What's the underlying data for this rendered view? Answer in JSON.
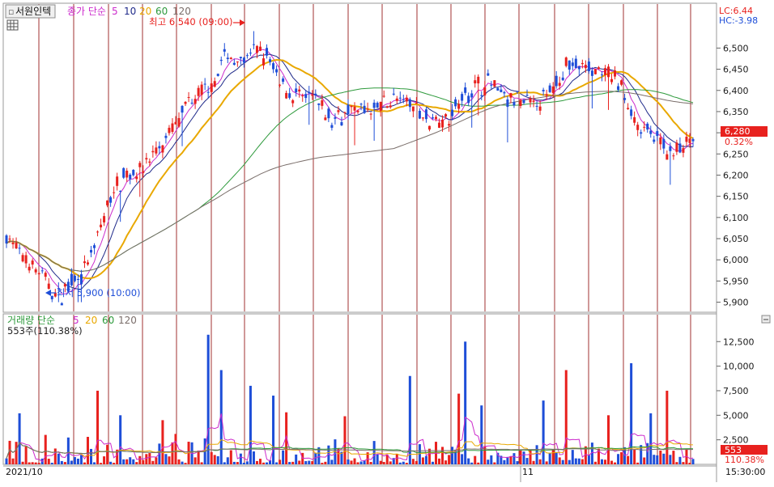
{
  "header": {
    "stock_name": "서원인텍",
    "price_legend_label": "종가 단순",
    "ma_periods": [
      "5",
      "10",
      "20",
      "60",
      "120"
    ],
    "volume_legend_label": "거래량 단순",
    "volume_ma_periods": [
      "5",
      "20",
      "60",
      "120"
    ],
    "volume_readout": "553주(110.38%)",
    "lc": "LC:6.44",
    "hc": "HC:-3.98"
  },
  "annotations": {
    "high": "최고 6,540 (09:00)",
    "low": "최저 5,900 (10:00)"
  },
  "current": {
    "price_label": "6,280",
    "change_label": "0.32%",
    "volume_label": "553",
    "volume_pct_label": "110.38%"
  },
  "footer": {
    "date_left": "2021/10",
    "date_mid": "11",
    "time_right": "15:30:00"
  },
  "colors": {
    "up": "#e8211e",
    "down": "#1e4ed8",
    "ma5": "#cc2bcc",
    "ma10": "#1f2a8a",
    "ma20": "#e9a800",
    "ma60": "#2e9a3c",
    "ma120": "#7a6e6a",
    "grid": "#a03030",
    "axis_text": "#1a1a1a",
    "label_bg": "#e8211e"
  },
  "chart_data": {
    "type": "candlestick",
    "price_axis_ticks": [
      "6,500",
      "6,450",
      "6,400",
      "6,350",
      "6,300",
      "6,250",
      "6,200",
      "6,150",
      "6,100",
      "6,050",
      "6,000",
      "5,950",
      "5,900"
    ],
    "price_range": [
      5880,
      6560
    ],
    "volume_axis_ticks": [
      "12,500",
      "10,000",
      "7,500",
      "5,000",
      "2,500"
    ],
    "volume_range": [
      0,
      14500
    ],
    "high": 6540,
    "low": 5900,
    "last_price": 6280,
    "last_volume": 553,
    "price_anchors": [
      [
        0,
        6060
      ],
      [
        4,
        6010
      ],
      [
        8,
        5990
      ],
      [
        12,
        5950
      ],
      [
        16,
        5910
      ],
      [
        20,
        5950
      ],
      [
        24,
        5970
      ],
      [
        28,
        6050
      ],
      [
        32,
        6150
      ],
      [
        36,
        6200
      ],
      [
        42,
        6220
      ],
      [
        48,
        6270
      ],
      [
        52,
        6320
      ],
      [
        57,
        6380
      ],
      [
        62,
        6400
      ],
      [
        67,
        6480
      ],
      [
        72,
        6470
      ],
      [
        76,
        6490
      ],
      [
        80,
        6480
      ],
      [
        84,
        6420
      ],
      [
        88,
        6390
      ],
      [
        94,
        6380
      ],
      [
        100,
        6330
      ],
      [
        106,
        6360
      ],
      [
        112,
        6350
      ],
      [
        118,
        6380
      ],
      [
        124,
        6370
      ],
      [
        130,
        6330
      ],
      [
        136,
        6340
      ],
      [
        142,
        6400
      ],
      [
        148,
        6420
      ],
      [
        154,
        6380
      ],
      [
        160,
        6370
      ],
      [
        166,
        6380
      ],
      [
        172,
        6460
      ],
      [
        180,
        6450
      ],
      [
        188,
        6420
      ],
      [
        194,
        6320
      ],
      [
        200,
        6280
      ],
      [
        205,
        6250
      ],
      [
        211,
        6280
      ]
    ],
    "volume_spikes": [
      [
        4,
        5200
      ],
      [
        12,
        3000
      ],
      [
        25,
        2800
      ],
      [
        28,
        7500
      ],
      [
        31,
        2000
      ],
      [
        35,
        5000
      ],
      [
        48,
        4500
      ],
      [
        52,
        3100
      ],
      [
        62,
        13200
      ],
      [
        66,
        9600
      ],
      [
        75,
        8000
      ],
      [
        82,
        7000
      ],
      [
        86,
        5300
      ],
      [
        104,
        4900
      ],
      [
        124,
        9000
      ],
      [
        139,
        7200
      ],
      [
        141,
        12500
      ],
      [
        146,
        6000
      ],
      [
        165,
        6500
      ],
      [
        172,
        9600
      ],
      [
        185,
        5000
      ],
      [
        192,
        10300
      ],
      [
        198,
        5200
      ],
      [
        203,
        7500
      ]
    ]
  }
}
